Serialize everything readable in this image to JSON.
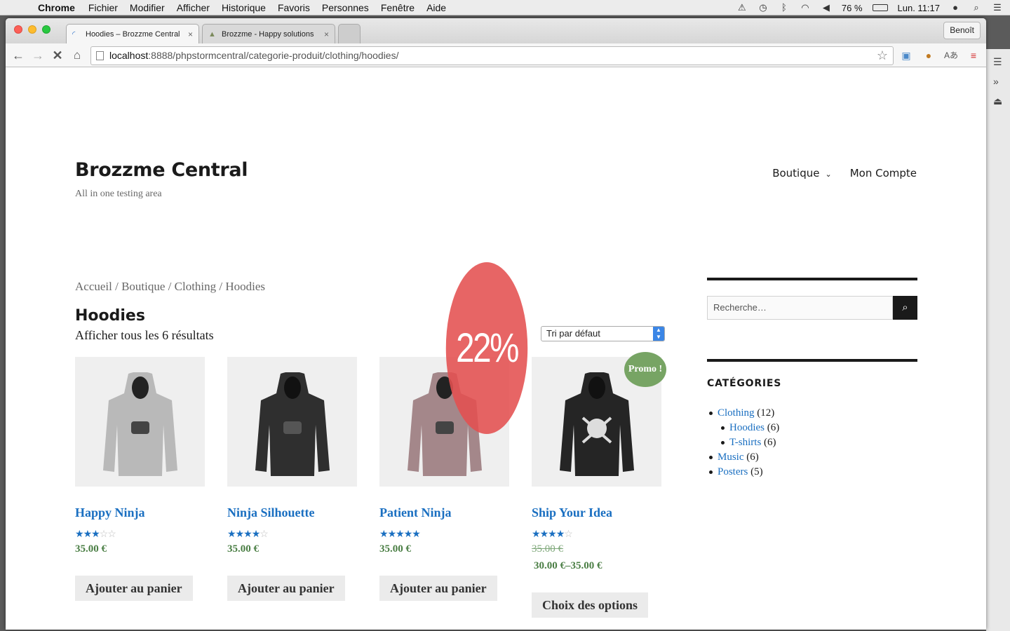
{
  "menubar": {
    "app": "Chrome",
    "items": [
      "Fichier",
      "Modifier",
      "Afficher",
      "Historique",
      "Favoris",
      "Personnes",
      "Fenêtre",
      "Aide"
    ],
    "battery": "76 %",
    "clock": "Lun. 11:17"
  },
  "browser": {
    "tabs": [
      {
        "title": "Hoodies – Brozzme Central"
      },
      {
        "title": "Brozzme - Happy solutions"
      }
    ],
    "profile": "Benoît",
    "url_host": "localhost",
    "url_path": ":8888/phpstormcentral/categorie-produit/clothing/hoodies/"
  },
  "site": {
    "title": "Brozzme Central",
    "tagline": "All in one testing area",
    "nav": [
      "Boutique",
      "Mon Compte"
    ]
  },
  "breadcrumb": "Accueil / Boutique / Clothing / Hoodies",
  "category": {
    "title": "Hoodies",
    "result_count": "Afficher tous les 6 résultats",
    "ordering": "Tri par défaut"
  },
  "sale_overlay": "22%",
  "products": [
    {
      "name": "Happy Ninja",
      "rating": 3,
      "price": "35.00 €",
      "button": "Ajouter au panier",
      "color": "#b9b9b9"
    },
    {
      "name": "Ninja Silhouette",
      "rating": 4,
      "price": "35.00 €",
      "button": "Ajouter au panier",
      "color": "#2f2f2f"
    },
    {
      "name": "Patient Ninja",
      "rating": 5,
      "price": "35.00 €",
      "button": "Ajouter au panier",
      "color": "#a4878a"
    },
    {
      "name": "Ship Your Idea",
      "rating": 4,
      "old_price": "35.00 €",
      "price_range": "30.00 €–35.00 €",
      "button": "Choix des options",
      "badge": "Promo !",
      "color": "#252525"
    }
  ],
  "sidebar": {
    "search_placeholder": "Recherche…",
    "categories_title": "CATÉGORIES",
    "categories": [
      {
        "name": "Clothing",
        "count": "(12)",
        "children": [
          {
            "name": "Hoodies",
            "count": "(6)"
          },
          {
            "name": "T-shirts",
            "count": "(6)"
          }
        ]
      },
      {
        "name": "Music",
        "count": "(6)"
      },
      {
        "name": "Posters",
        "count": "(5)"
      }
    ]
  }
}
